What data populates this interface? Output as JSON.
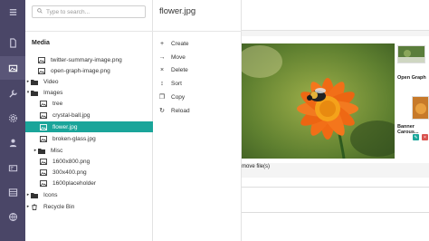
{
  "search": {
    "placeholder": "Type to search..."
  },
  "tree": {
    "title": "Media",
    "items": [
      {
        "label": "twitter-summary-image.png",
        "type": "image",
        "depth": 1
      },
      {
        "label": "open-graph-image.png",
        "type": "image",
        "depth": 1
      },
      {
        "label": "Video",
        "type": "folder",
        "depth": 0,
        "caret": "right"
      },
      {
        "label": "Images",
        "type": "folder",
        "depth": 0,
        "caret": "down"
      },
      {
        "label": "tree",
        "type": "image",
        "depth": 2
      },
      {
        "label": "crystal-ball.jpg",
        "type": "image",
        "depth": 2
      },
      {
        "label": "flower.jpg",
        "type": "image",
        "depth": 2,
        "selected": true
      },
      {
        "label": "broken-glass.jpg",
        "type": "image",
        "depth": 2
      },
      {
        "label": "Misc",
        "type": "folder",
        "depth": 1,
        "caret": "right"
      },
      {
        "label": "1600x800.png",
        "type": "image",
        "depth": 2
      },
      {
        "label": "300x400.png",
        "type": "image",
        "depth": 2
      },
      {
        "label": "1600placeholder",
        "type": "image",
        "depth": 2
      },
      {
        "label": "Icons",
        "type": "folder",
        "depth": 0,
        "caret": "right"
      },
      {
        "label": "Recycle Bin",
        "type": "trash",
        "depth": 0,
        "caret": "right"
      }
    ]
  },
  "context_menu": {
    "title": "flower.jpg",
    "items": [
      {
        "label": "Create",
        "icon": "plus-icon"
      },
      {
        "label": "Move",
        "icon": "move-icon"
      },
      {
        "label": "Delete",
        "icon": "delete-icon"
      },
      {
        "label": "Sort",
        "icon": "sort-icon"
      },
      {
        "label": "Copy",
        "icon": "copy-icon"
      },
      {
        "label": "Reload",
        "icon": "reload-icon"
      }
    ]
  },
  "background": {
    "moved_text": "move file(s)",
    "thumbs": [
      {
        "caption": "Open Graph"
      },
      {
        "caption": "Banner Carous..."
      }
    ]
  },
  "colors": {
    "rail": "#4a4667",
    "accent": "#1aa59a"
  }
}
